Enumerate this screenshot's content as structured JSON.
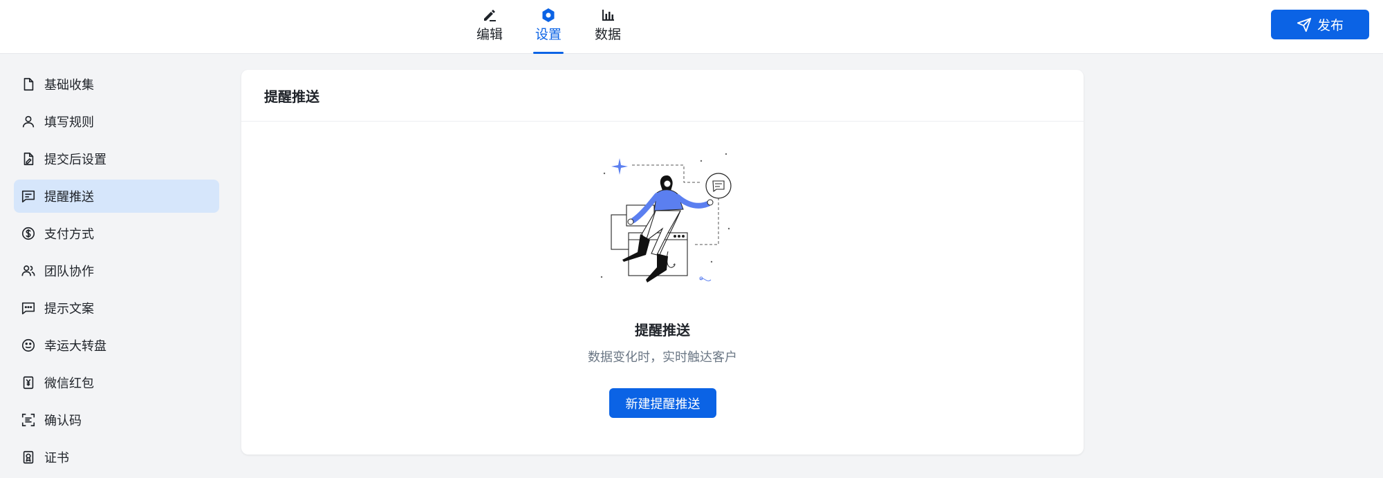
{
  "topbar": {
    "tabs": [
      {
        "label": "编辑",
        "icon": "pen-icon"
      },
      {
        "label": "设置",
        "icon": "hexagon-settings-icon",
        "active": true
      },
      {
        "label": "数据",
        "icon": "bar-chart-icon"
      }
    ],
    "publish_label": "发布"
  },
  "sidebar": {
    "items": [
      {
        "label": "基础收集",
        "icon": "document-icon"
      },
      {
        "label": "填写规则",
        "icon": "user-icon"
      },
      {
        "label": "提交后设置",
        "icon": "file-edit-icon"
      },
      {
        "label": "提醒推送",
        "icon": "message-icon",
        "active": true
      },
      {
        "label": "支付方式",
        "icon": "dollar-icon"
      },
      {
        "label": "团队协作",
        "icon": "users-icon"
      },
      {
        "label": "提示文案",
        "icon": "chat-dots-icon"
      },
      {
        "label": "幸运大转盘",
        "icon": "smile-icon"
      },
      {
        "label": "微信红包",
        "icon": "red-packet-icon"
      },
      {
        "label": "确认码",
        "icon": "scan-code-icon"
      },
      {
        "label": "证书",
        "icon": "certificate-icon"
      }
    ]
  },
  "card": {
    "title": "提醒推送",
    "empty_title": "提醒推送",
    "empty_subtitle": "数据变化时，实时触达客户",
    "create_button": "新建提醒推送"
  },
  "colors": {
    "primary": "#0b63e5",
    "active_bg": "#d6e6fb",
    "page_bg": "#f3f4f6",
    "illustration_accent": "#5b7ff0"
  }
}
